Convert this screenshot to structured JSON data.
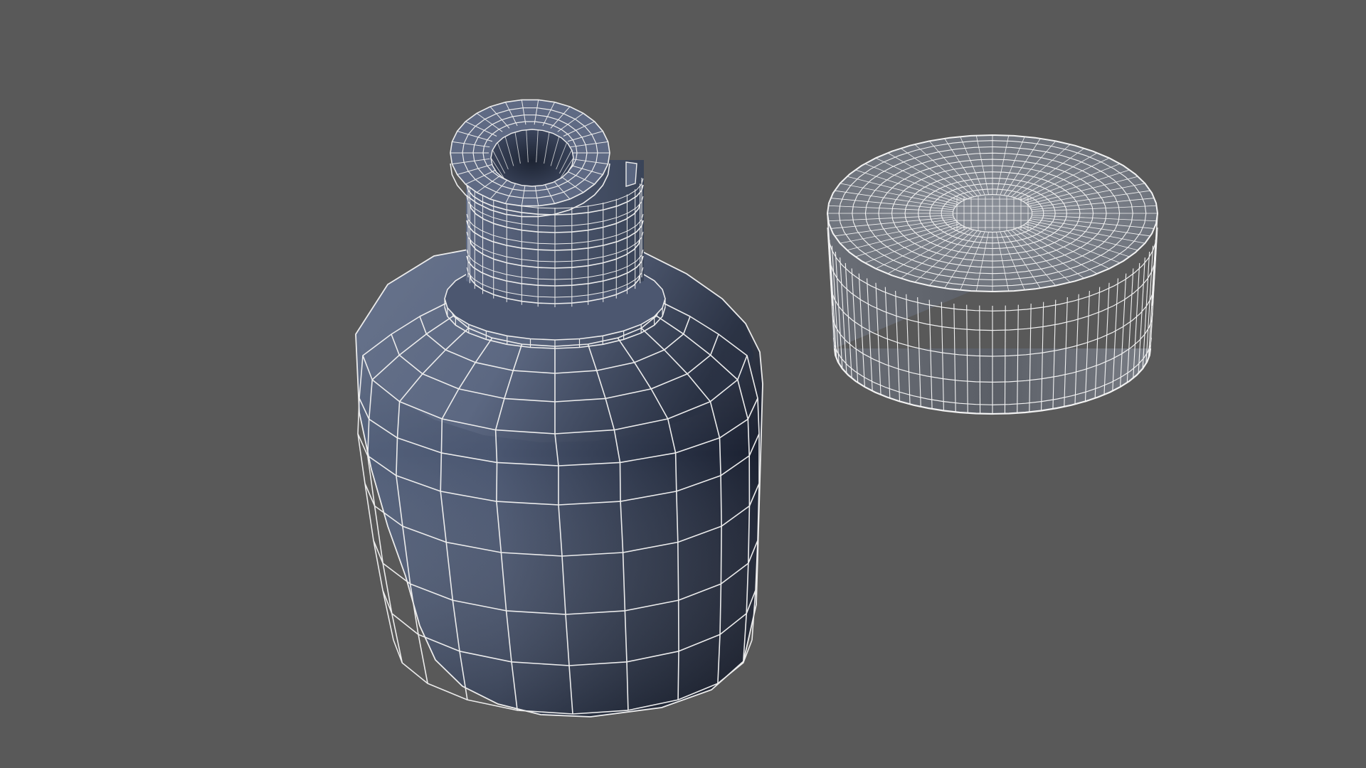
{
  "viewport": {
    "background": "#595959"
  },
  "scene": {
    "objects": [
      {
        "name": "bottle",
        "display": "wireframe-on-shaded",
        "shade_light": "#6e7890",
        "shade_dark": "#1b2232",
        "wire_color": "#ececec"
      },
      {
        "name": "cap",
        "display": "wireframe-on-shaded",
        "shade_light": "#a6aab2",
        "shade_dark": "#5a5e66",
        "wire_color": "#f2f2f2"
      }
    ]
  }
}
